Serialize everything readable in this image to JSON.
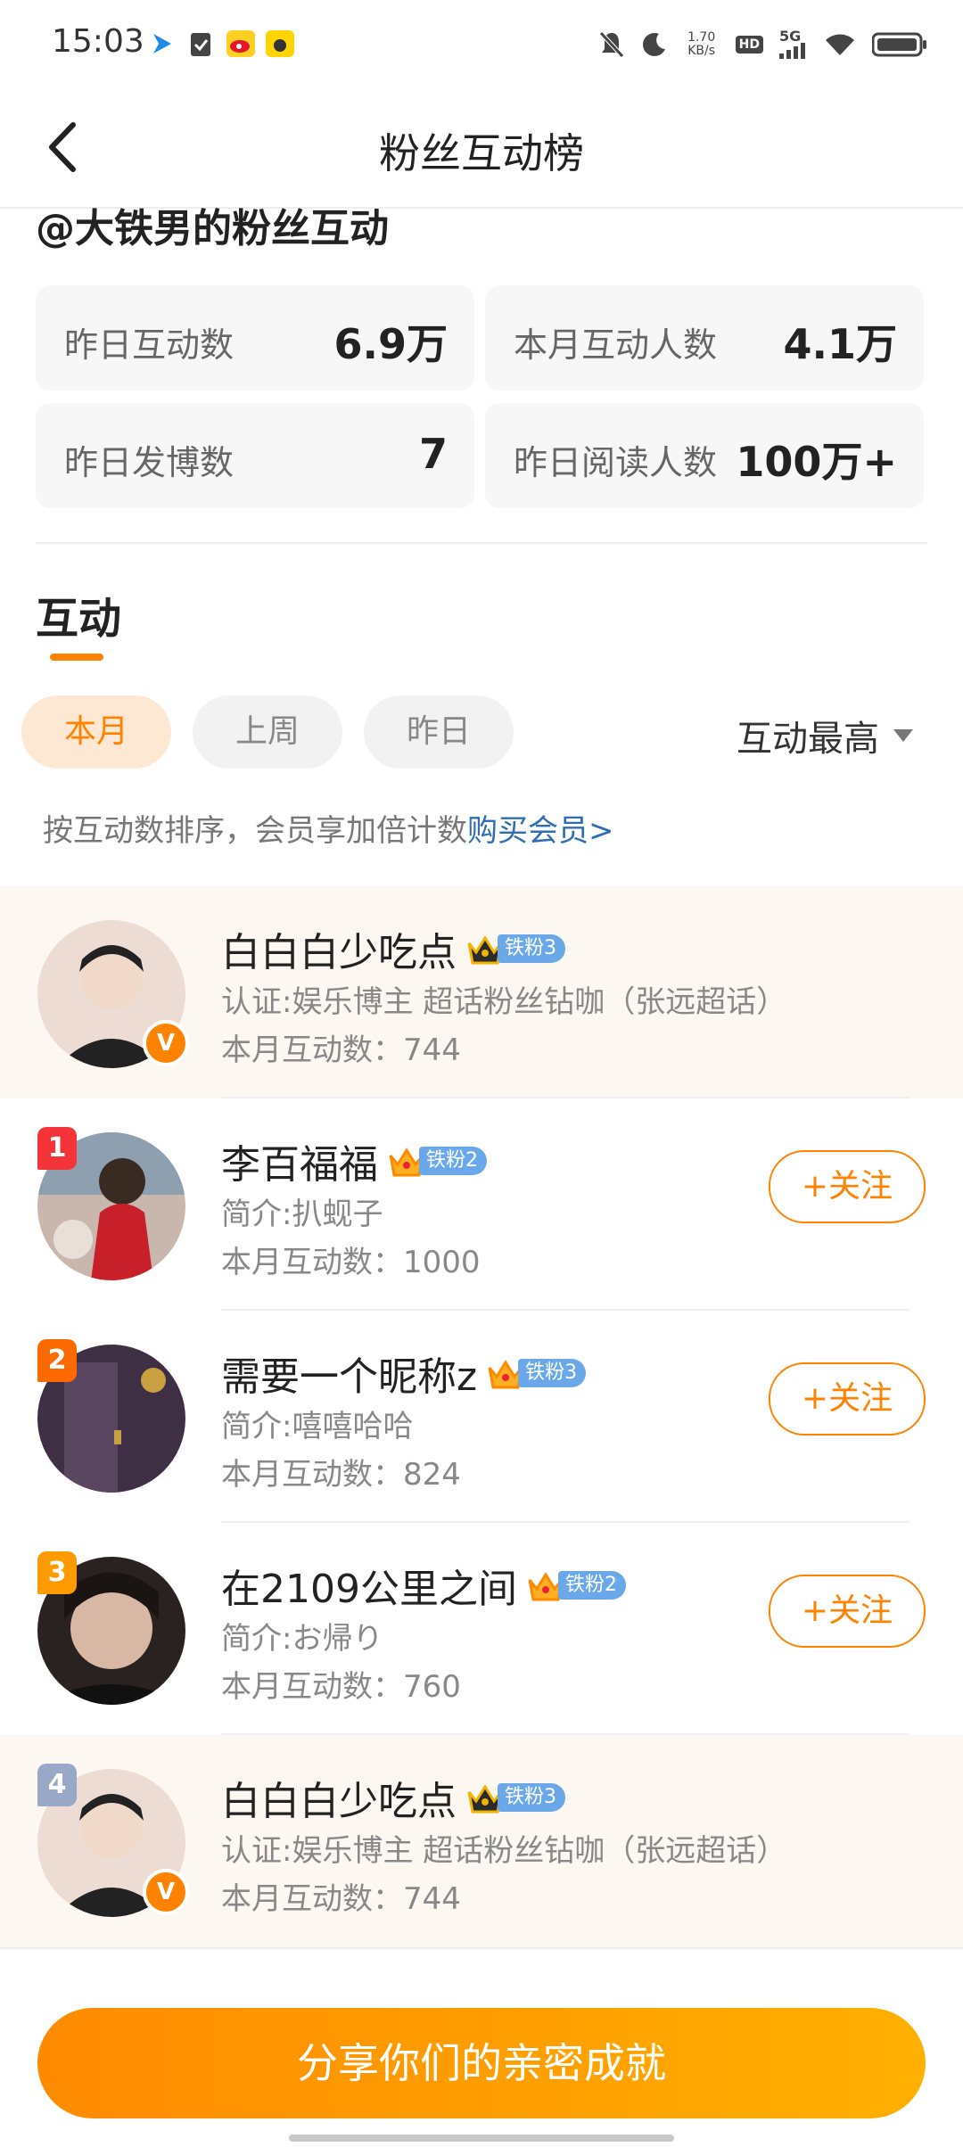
{
  "status_bar": {
    "time": "15:03",
    "net_speed_value": "1.70",
    "net_speed_unit": "KB/s",
    "hd": "HD",
    "network": "5G"
  },
  "header": {
    "title": "粉丝互动榜"
  },
  "page": {
    "handle": "@大铁男的粉丝互动"
  },
  "stats": [
    {
      "label": "昨日互动数",
      "value": "6.9万"
    },
    {
      "label": "本月互动人数",
      "value": "4.1万"
    },
    {
      "label": "昨日发博数",
      "value": "7"
    },
    {
      "label": "昨日阅读人数",
      "value": "100万+"
    }
  ],
  "section": {
    "title": "互动"
  },
  "filters": [
    "本月",
    "上周",
    "昨日"
  ],
  "sort": {
    "label": "互动最高"
  },
  "hint": {
    "text": "按互动数排序，会员享加倍计数",
    "link": "购买会员>"
  },
  "list": [
    {
      "rank": "",
      "name": "白白白少吃点",
      "badge": "铁粉3",
      "desc": "认证:娱乐博主 超话粉丝钻咖（张远超话）",
      "count": "本月互动数：744",
      "verified_mark": "V",
      "rank_color": "",
      "avatar_color": "#d8c9c0"
    },
    {
      "rank": "1",
      "name": "李百福福",
      "badge": "铁粉2",
      "desc": "简介:扒蚬子",
      "count": "本月互动数：1000",
      "follow": "+关注",
      "rank_color": "#f5343a",
      "avatar_color": "#b98a6a"
    },
    {
      "rank": "2",
      "name": "需要一个昵称z",
      "badge": "铁粉3",
      "desc": "简介:嘻嘻哈哈",
      "count": "本月互动数：824",
      "follow": "+关注",
      "rank_color": "#ff6a00",
      "avatar_color": "#4a3a4e"
    },
    {
      "rank": "3",
      "name": "在2109公里之间",
      "badge": "铁粉2",
      "desc": "简介:お帰り",
      "count": "本月互动数：760",
      "follow": "+关注",
      "rank_color": "#ff9a00",
      "avatar_color": "#3a2e2a"
    },
    {
      "rank": "4",
      "name": "白白白少吃点",
      "badge": "铁粉3",
      "desc": "认证:娱乐博主 超话粉丝钻咖（张远超话）",
      "count": "本月互动数：744",
      "verified_mark": "V",
      "rank_color": "#9aa8c8",
      "avatar_color": "#d8c9c0"
    }
  ],
  "share_button": "分享你们的亲密成就",
  "colors": {
    "accent": "#ff8200",
    "link": "#2f6db4",
    "badge_blue": "#6aa8ea"
  }
}
